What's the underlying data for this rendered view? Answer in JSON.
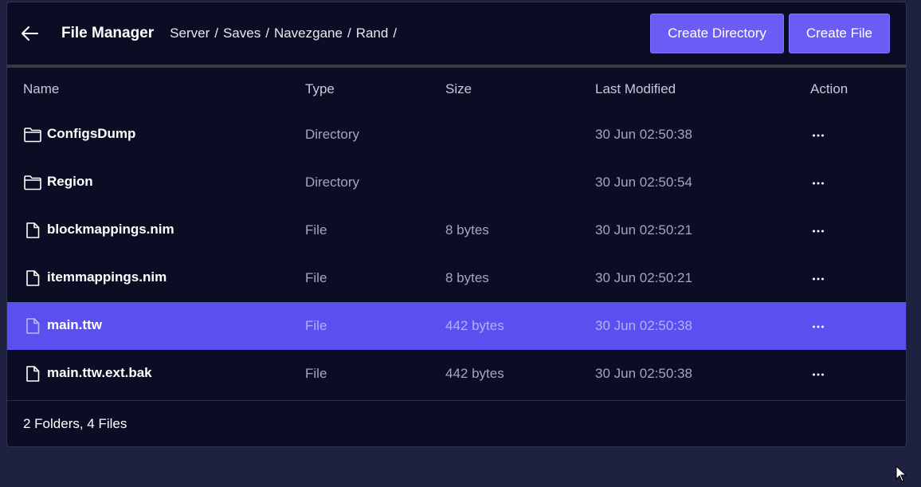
{
  "header": {
    "title": "File Manager",
    "breadcrumb": [
      "Server",
      "Saves",
      "Navezgane",
      "Rand"
    ],
    "separator": "/",
    "create_directory_label": "Create Directory",
    "create_file_label": "Create File"
  },
  "table": {
    "columns": [
      "Name",
      "Type",
      "Size",
      "Last Modified",
      "Action"
    ],
    "rows": [
      {
        "icon": "folder-icon",
        "name": "ConfigsDump",
        "type": "Directory",
        "size": "",
        "modified": "30 Jun 02:50:38"
      },
      {
        "icon": "folder-icon",
        "name": "Region",
        "type": "Directory",
        "size": "",
        "modified": "30 Jun 02:50:54"
      },
      {
        "icon": "file-icon",
        "name": "blockmappings.nim",
        "type": "File",
        "size": "8 bytes",
        "modified": "30 Jun 02:50:21"
      },
      {
        "icon": "file-icon",
        "name": "itemmappings.nim",
        "type": "File",
        "size": "8 bytes",
        "modified": "30 Jun 02:50:21"
      },
      {
        "icon": "file-icon",
        "name": "main.ttw",
        "type": "File",
        "size": "442 bytes",
        "modified": "30 Jun 02:50:38",
        "selected": true
      },
      {
        "icon": "file-icon",
        "name": "main.ttw.ext.bak",
        "type": "File",
        "size": "442 bytes",
        "modified": "30 Jun 02:50:38"
      }
    ]
  },
  "footer": {
    "summary": "2 Folders, 4 Files"
  },
  "colors": {
    "background": "#1f2140",
    "panel": "#0b0d24",
    "accent": "#6b5cf6",
    "selected_row": "#5a50ef"
  }
}
